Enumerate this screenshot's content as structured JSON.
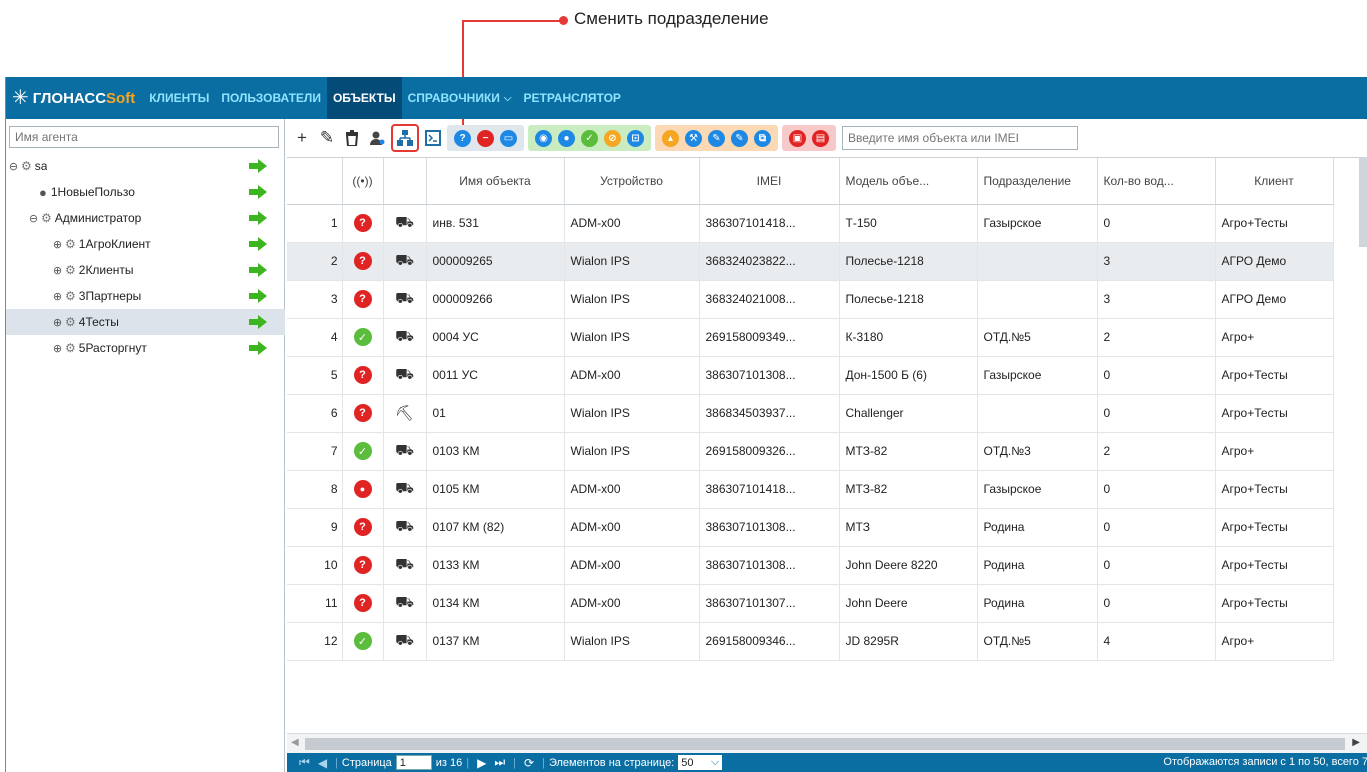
{
  "callout": {
    "text": "Сменить подразделение"
  },
  "nav": {
    "logo_a": "ГЛОНАСС",
    "logo_b": "Soft",
    "items": [
      "КЛИЕНТЫ",
      "ПОЛЬЗОВАТЕЛИ",
      "ОБЪЕКТЫ",
      "СПРАВОЧНИКИ",
      "РЕТРАНСЛЯТОР"
    ],
    "active": "ОБЪЕКТЫ"
  },
  "agent_search": {
    "placeholder": "Имя агента"
  },
  "tree": [
    {
      "label": "sa",
      "level": 0,
      "expander": "⊖",
      "kind": "group"
    },
    {
      "label": "1НовыеПользо",
      "level": 1,
      "expander": "",
      "kind": "user"
    },
    {
      "label": "Администратор",
      "level": 1,
      "expander": "⊖",
      "kind": "group"
    },
    {
      "label": "1АгроКлиент",
      "level": 2,
      "expander": "⊕",
      "kind": "group"
    },
    {
      "label": "2Клиенты",
      "level": 2,
      "expander": "⊕",
      "kind": "group"
    },
    {
      "label": "3Партнеры",
      "level": 2,
      "expander": "⊕",
      "kind": "group"
    },
    {
      "label": "4Тесты",
      "level": 2,
      "expander": "⊕",
      "kind": "group",
      "selected": true
    },
    {
      "label": "5Расторгнут",
      "level": 2,
      "expander": "⊕",
      "kind": "group"
    }
  ],
  "colors": {
    "nav_bg": "#0b6ea2",
    "nav_active": "#054b78",
    "status_red": "#e02424",
    "status_green": "#5bbd3b",
    "arrow_green": "#3cb521",
    "highlight_red": "#e53935"
  },
  "object_search": {
    "placeholder": "Введите имя объекта или IMEI"
  },
  "columns": {
    "conn": "((•))",
    "name": "Имя объекта",
    "device": "Устройство",
    "imei": "IMEI",
    "model": "Модель объе...",
    "division": "Подразделение",
    "drivers": "Кол-во вод...",
    "client": "Клиент"
  },
  "rows": [
    {
      "n": "1",
      "status": "unknown",
      "veh": "harvester",
      "name": "инв. 531",
      "device": "ADM-x00",
      "imei": "386307101418...",
      "model": "Т-150",
      "division": "Газырское",
      "drivers": "0",
      "client": "Агро+Тесты"
    },
    {
      "n": "2",
      "status": "unknown",
      "veh": "truck",
      "name": "000009265",
      "device": "Wialon IPS",
      "imei": "368324023822...",
      "model": "Полесье-1218",
      "division": "",
      "drivers": "3",
      "client": "АГРО Демо"
    },
    {
      "n": "3",
      "status": "unknown",
      "veh": "truck",
      "name": "000009266",
      "device": "Wialon IPS",
      "imei": "368324021008...",
      "model": "Полесье-1218",
      "division": "",
      "drivers": "3",
      "client": "АГРО Демо"
    },
    {
      "n": "4",
      "status": "ok",
      "veh": "harvester",
      "name": "0004 УС",
      "device": "Wialon IPS",
      "imei": "269158009349...",
      "model": "К-3180",
      "division": "ОТД.№5",
      "drivers": "2",
      "client": "Агро+"
    },
    {
      "n": "5",
      "status": "unknown",
      "veh": "truck",
      "name": "0011 УС",
      "device": "ADM-x00",
      "imei": "386307101308...",
      "model": "Дон-1500 Б (6)",
      "division": "Газырское",
      "drivers": "0",
      "client": "Агро+Тесты"
    },
    {
      "n": "6",
      "status": "unknown",
      "veh": "bulldozer",
      "name": "01",
      "device": "Wialon IPS",
      "imei": "386834503937...",
      "model": "Challenger",
      "division": "",
      "drivers": "0",
      "client": "Агро+Тесты"
    },
    {
      "n": "7",
      "status": "ok",
      "veh": "harvester",
      "name": "0103 КМ",
      "device": "Wialon IPS",
      "imei": "269158009326...",
      "model": "МТЗ-82",
      "division": "ОТД.№3",
      "drivers": "2",
      "client": "Агро+"
    },
    {
      "n": "8",
      "status": "locked",
      "veh": "harvester",
      "name": "0105 КМ",
      "device": "ADM-x00",
      "imei": "386307101418...",
      "model": "МТЗ-82",
      "division": "Газырское",
      "drivers": "0",
      "client": "Агро+Тесты"
    },
    {
      "n": "9",
      "status": "unknown",
      "veh": "harvester",
      "name": "0107 КМ (82)",
      "device": "ADM-x00",
      "imei": "386307101308...",
      "model": "МТЗ",
      "division": "Родина",
      "drivers": "0",
      "client": "Агро+Тесты"
    },
    {
      "n": "10",
      "status": "unknown",
      "veh": "tractor",
      "name": "0133 КМ",
      "device": "ADM-x00",
      "imei": "386307101308...",
      "model": "John Deere 8220",
      "division": "Родина",
      "drivers": "0",
      "client": "Агро+Тесты"
    },
    {
      "n": "11",
      "status": "unknown",
      "veh": "tractor",
      "name": "0134 КМ",
      "device": "ADM-x00",
      "imei": "386307101307...",
      "model": "John Deere",
      "division": "Родина",
      "drivers": "0",
      "client": "Агро+Тесты"
    },
    {
      "n": "12",
      "status": "ok",
      "veh": "tractor",
      "name": "0137 КМ",
      "device": "Wialon IPS",
      "imei": "269158009346...",
      "model": "JD 8295R",
      "division": "ОТД.№5",
      "drivers": "4",
      "client": "Агро+"
    }
  ],
  "pager": {
    "page_label": "Страница",
    "page": "1",
    "of_label": "из 16",
    "per_page_label": "Элементов на странице:",
    "per_page": "50",
    "summary": "Отображаются записи с 1 по 50, всего 7"
  }
}
